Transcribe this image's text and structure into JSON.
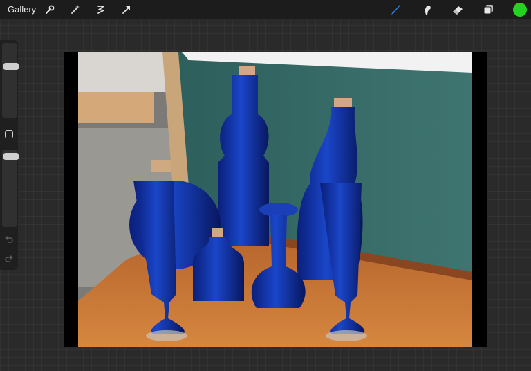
{
  "app": {
    "gallery_label": "Gallery"
  },
  "toolbar": {
    "left_tools": [
      "wrench-icon",
      "magic-wand-icon",
      "selection-icon",
      "transform-arrow-icon"
    ],
    "right_tools": [
      "brush-icon",
      "smudge-icon",
      "eraser-icon",
      "layers-icon"
    ],
    "active_tool": "brush-icon",
    "current_color": "#22d41f",
    "accent_color": "#2f7de0"
  },
  "sidebar": {
    "brush_size_level": 0.7,
    "opacity_level": 0.95,
    "undo_icon": "undo-icon",
    "redo_icon": "redo-icon"
  },
  "canvas": {
    "background": "#000000"
  }
}
